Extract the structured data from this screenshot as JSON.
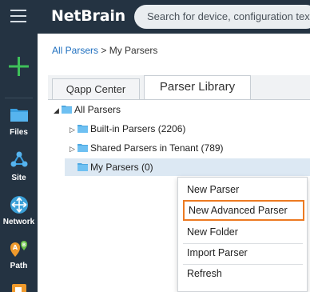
{
  "header": {
    "logo_text": "NetBrain",
    "search_placeholder": "Search for device, configuration text..."
  },
  "rail": {
    "items": [
      {
        "label": "Files",
        "icon": "folder-icon"
      },
      {
        "label": "Site",
        "icon": "site-icon"
      },
      {
        "label": "Network",
        "icon": "network-icon"
      },
      {
        "label": "Path",
        "icon": "path-icon"
      }
    ]
  },
  "breadcrumb": {
    "link": "All Parsers",
    "separator": ">",
    "current": "My Parsers"
  },
  "tabs": [
    {
      "label": "Qapp Center",
      "active": false
    },
    {
      "label": "Parser Library",
      "active": true
    }
  ],
  "tree": {
    "root": "All Parsers",
    "children": [
      {
        "label": "Built-in Parsers (2206)"
      },
      {
        "label": "Shared Parsers in Tenant (789)"
      },
      {
        "label": "My Parsers (0)"
      }
    ]
  },
  "context_menu": {
    "items": [
      "New Parser",
      "New Advanced Parser",
      "New Folder",
      "Import Parser",
      "Refresh"
    ],
    "highlighted": "New Advanced Parser"
  },
  "colors": {
    "topbar": "#243342",
    "highlight_border": "#ec7a22",
    "folder": "#4fa8e0",
    "link": "#1e6fbf",
    "add_button": "#3ec15a"
  }
}
